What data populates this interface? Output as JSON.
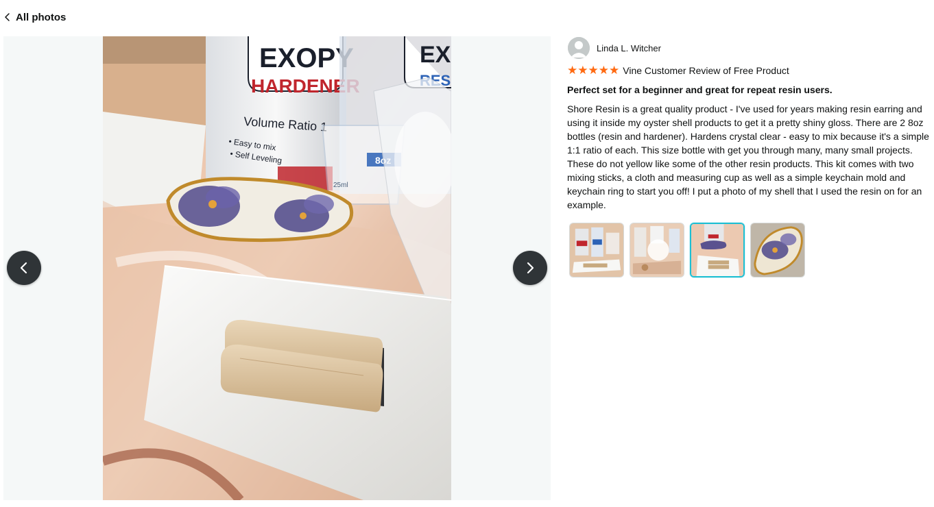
{
  "header": {
    "back_label": "All photos"
  },
  "review": {
    "reviewer_name": "Linda L. Witcher",
    "rating": 5,
    "rating_max": 5,
    "star_glyph": "★",
    "badge": "Vine Customer Review of Free Product",
    "title": "Perfect set for a beginner and great for repeat resin users.",
    "body": "Shore Resin is a great quality product - I've used for years making resin earring and using it inside my oyster shell products to get it a pretty shiny gloss. There are 2 8oz bottles (resin and hardener). Hardens crystal clear - easy to mix because it's a simple 1:1 ratio of each. This size bottle with get you through many, many small projects. These do not yellow like some of the other resin products. This kit comes with two mixing sticks, a cloth and measuring cup as well as a simple keychain mold and keychain ring to start you off! I put a photo of my shell that I used the resin on for an example."
  },
  "photo": {
    "bottle_brand": "EXOPY",
    "bottle_brand_partial": "EXO",
    "bottle_label": "HARDENER",
    "bottle_label_partial": "RES",
    "bottle_subtitle": "Volume Ratio 1",
    "bottle_feature_1": "• Easy to mix",
    "bottle_feature_2": "• Self Leveling",
    "cup_label": "8oz",
    "cup_mark": "25ml"
  },
  "gallery": {
    "selected_index": 2,
    "thumbnails": [
      "photo-1",
      "photo-2",
      "photo-3",
      "photo-4"
    ]
  },
  "icons": {
    "back": "chevron-left-icon",
    "prev": "arrow-left-icon",
    "next": "arrow-right-icon",
    "avatar": "default-avatar-icon",
    "star": "star-icon"
  },
  "colors": {
    "star": "#ff6a12",
    "nav_button": "#2f3437",
    "selected_thumb_border": "#1dbfd3"
  }
}
